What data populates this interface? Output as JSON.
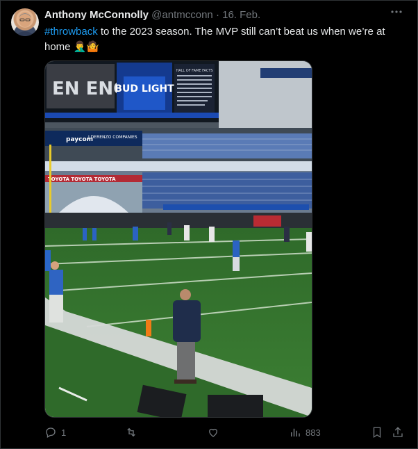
{
  "post": {
    "author_name": "Anthony McConnolly",
    "handle": "@antmcconn",
    "separator": "·",
    "date": "16. Feb.",
    "hashtag": "#throwback",
    "text_after_hashtag": " to the 2023 season. The MVP still can’t beat us when we’re at home",
    "emojis": "🤦‍♂️🤷"
  },
  "stadium_signage": {
    "brand": "BUD LIGHT",
    "facts_title": "HALL OF FAME FACTS",
    "sponsor_left": "paycom",
    "sponsor_right": "J.DERENZO COMPANIES",
    "banner": "TOYOTA TOYOTA TOYOTA"
  },
  "actions": {
    "reply_count": "1",
    "retweet_count": "",
    "like_count": "",
    "views_count": "883"
  },
  "icons": [
    "more-icon",
    "reply-icon",
    "retweet-icon",
    "like-icon",
    "views-icon",
    "bookmark-icon",
    "share-icon"
  ]
}
